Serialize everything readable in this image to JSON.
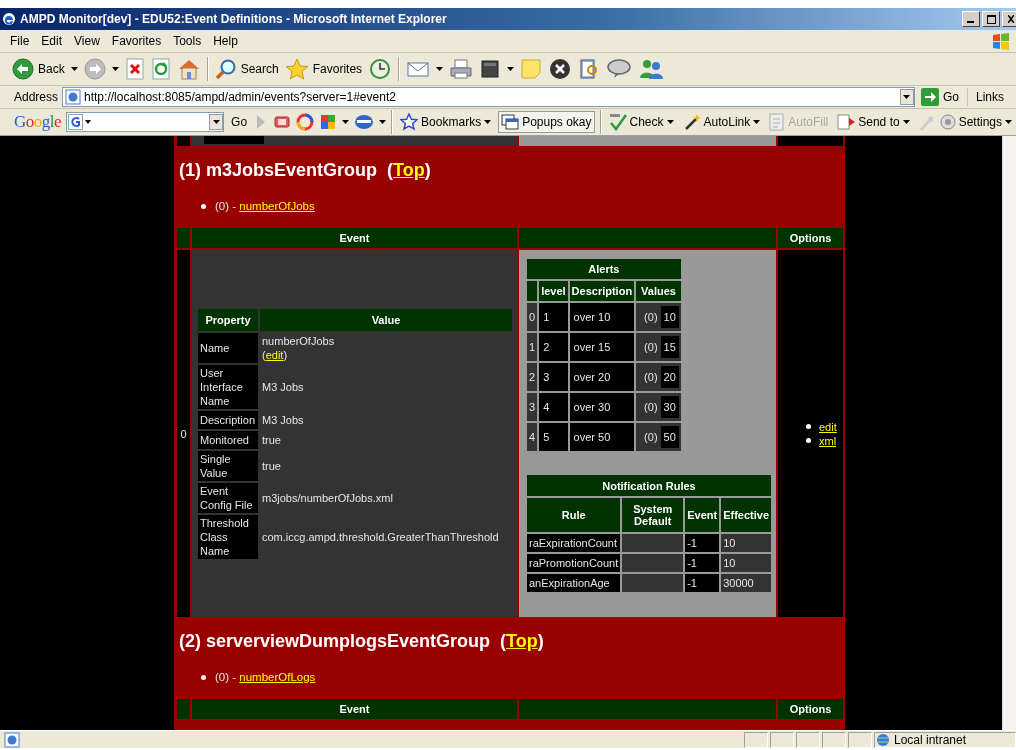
{
  "window": {
    "title": "AMPD Monitor[dev] - EDU52:Event Definitions - Microsoft Internet Explorer"
  },
  "menu": [
    "File",
    "Edit",
    "View",
    "Favorites",
    "Tools",
    "Help"
  ],
  "toolbar": {
    "back": "Back",
    "search": "Search",
    "favorites": "Favorites"
  },
  "address": {
    "label": "Address",
    "url": "http://localhost:8085/ampd/admin/events?server=1#event2",
    "go": "Go",
    "links": "Links"
  },
  "google_bar": {
    "logo": "Google",
    "go": "Go",
    "bookmarks": "Bookmarks",
    "popups": "Popups okay",
    "check": "Check",
    "autolink": "AutoLink",
    "autofill": {
      "label": "AutoFill",
      "disabled": true
    },
    "send_to": "Send to",
    "settings": "Settings"
  },
  "groups": [
    {
      "heading": {
        "before": "(1) m3JobsEventGroup  (",
        "link": "Top",
        "after": ")"
      },
      "events": [
        {
          "prefix": "(0) - ",
          "link": "numberOfJobs"
        }
      ],
      "table": {
        "columns": [
          "Event",
          "",
          "Options"
        ],
        "rows": [
          {
            "index": "0",
            "properties": {
              "columns": [
                "Property",
                "Value"
              ],
              "rows": [
                {
                  "property": "Name",
                  "value": "numberOfJobs",
                  "edit": {
                    "before": "(",
                    "link": "edit",
                    "after": ")"
                  }
                },
                {
                  "property": "User Interface Name",
                  "value": "M3 Jobs"
                },
                {
                  "property": "Description",
                  "value": "M3 Jobs"
                },
                {
                  "property": "Monitored",
                  "value": "true"
                },
                {
                  "property": "Single Value",
                  "value": "true"
                },
                {
                  "property": "Event Config File",
                  "value": "m3jobs/numberOfJobs.xml"
                },
                {
                  "property": "Threshold Class Name",
                  "value": "com.iccg.ampd.threshold.GreaterThanThreshold"
                }
              ]
            },
            "alerts": {
              "title": "Alerts",
              "columns": [
                "level",
                "Description",
                "Values"
              ],
              "rows": [
                {
                  "index": "0",
                  "level": "1",
                  "description": "over 10",
                  "count": "(0)",
                  "value": "10"
                },
                {
                  "index": "1",
                  "level": "2",
                  "description": "over 15",
                  "count": "(0)",
                  "value": "15"
                },
                {
                  "index": "2",
                  "level": "3",
                  "description": "over 20",
                  "count": "(0)",
                  "value": "20"
                },
                {
                  "index": "3",
                  "level": "4",
                  "description": "over 30",
                  "count": "(0)",
                  "value": "30"
                },
                {
                  "index": "4",
                  "level": "5",
                  "description": "over 50",
                  "count": "(0)",
                  "value": "50"
                }
              ]
            },
            "notification_rules": {
              "title": "Notification Rules",
              "columns": [
                "Rule",
                "System Default",
                "Event",
                "Effective"
              ],
              "rows": [
                {
                  "rule": "raExpirationCount",
                  "event": "-1",
                  "effective": "10"
                },
                {
                  "rule": "raPromotionCount",
                  "event": "-1",
                  "effective": "10"
                },
                {
                  "rule": "anExpirationAge",
                  "event": "-1",
                  "effective": "30000"
                }
              ]
            },
            "options": [
              "edit",
              "xml"
            ]
          }
        ]
      }
    },
    {
      "heading": {
        "before": "(2) serverviewDumplogsEventGroup  (",
        "link": "Top",
        "after": ")"
      },
      "events": [
        {
          "prefix": "(0) - ",
          "link": "numberOfLogs"
        }
      ],
      "table": {
        "columns": [
          "Event",
          "",
          "Options"
        ]
      }
    }
  ],
  "status_bar": {
    "zone": "Local intranet"
  }
}
